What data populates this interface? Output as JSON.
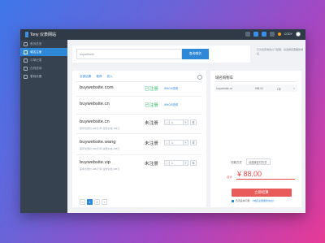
{
  "app": {
    "name": "Tony 仪表网站"
  },
  "topbar": {
    "user": "CODY"
  },
  "sidebar": {
    "items": [
      {
        "label": "首页总览",
        "icon": "home-icon"
      },
      {
        "label": "域名注册",
        "icon": "globe-icon",
        "active": true
      },
      {
        "label": "订单记录",
        "icon": "list-icon"
      },
      {
        "label": "在线咨询",
        "icon": "chat-icon"
      },
      {
        "label": "基础设置",
        "icon": "settings-icon"
      }
    ]
  },
  "search": {
    "value": "buywebsite",
    "button": "查询域名"
  },
  "tip": "已为您查询到以下结果，请选择您需要的域名",
  "results": {
    "tabs": [
      "全部结果",
      "推荐",
      "收入"
    ],
    "rows": [
      {
        "domain": "buywebsite.com",
        "status": "已注册",
        "registered": true,
        "whois": "WHOIS查看",
        "sub": ""
      },
      {
        "domain": "buywebsite.cn",
        "status": "已注册",
        "registered": true,
        "whois": "WHOIS查看",
        "sub": ""
      },
      {
        "domain": "buywebsite.cn",
        "status": "未注册",
        "registered": false,
        "qty": "1",
        "unit": "年",
        "sub": "首年优惠价 ¥88元/年  续费价格 ¥88元"
      },
      {
        "domain": "buywebsite.wang",
        "status": "未注册",
        "registered": false,
        "qty": "1",
        "unit": "年",
        "sub": "首年优惠价 ¥88元/年  续费价格 ¥88元"
      },
      {
        "domain": "buywebsite.vip",
        "status": "未注册",
        "registered": false,
        "qty": "1",
        "unit": "年",
        "sub": "首年优惠价 ¥88元/年  续费价格 ¥88元"
      }
    ],
    "pages": [
      "<",
      "1",
      "2",
      ">"
    ]
  },
  "cart": {
    "title": "域名购物车",
    "item": {
      "name": "buywebsite.cn",
      "price": "¥88.00",
      "years": "1年"
    },
    "pay_label": "付款方式",
    "pay_method": "请选择支付方式",
    "total_label": "合计",
    "total": "¥ 88.00",
    "buy_button": "立即结算",
    "agree_text": "已阅读并同意",
    "agree_link": "《域名注册服务协议》"
  },
  "colors": {
    "accent": "#2e88d8",
    "success": "#2dbd6e",
    "danger": "#e84b4b"
  }
}
